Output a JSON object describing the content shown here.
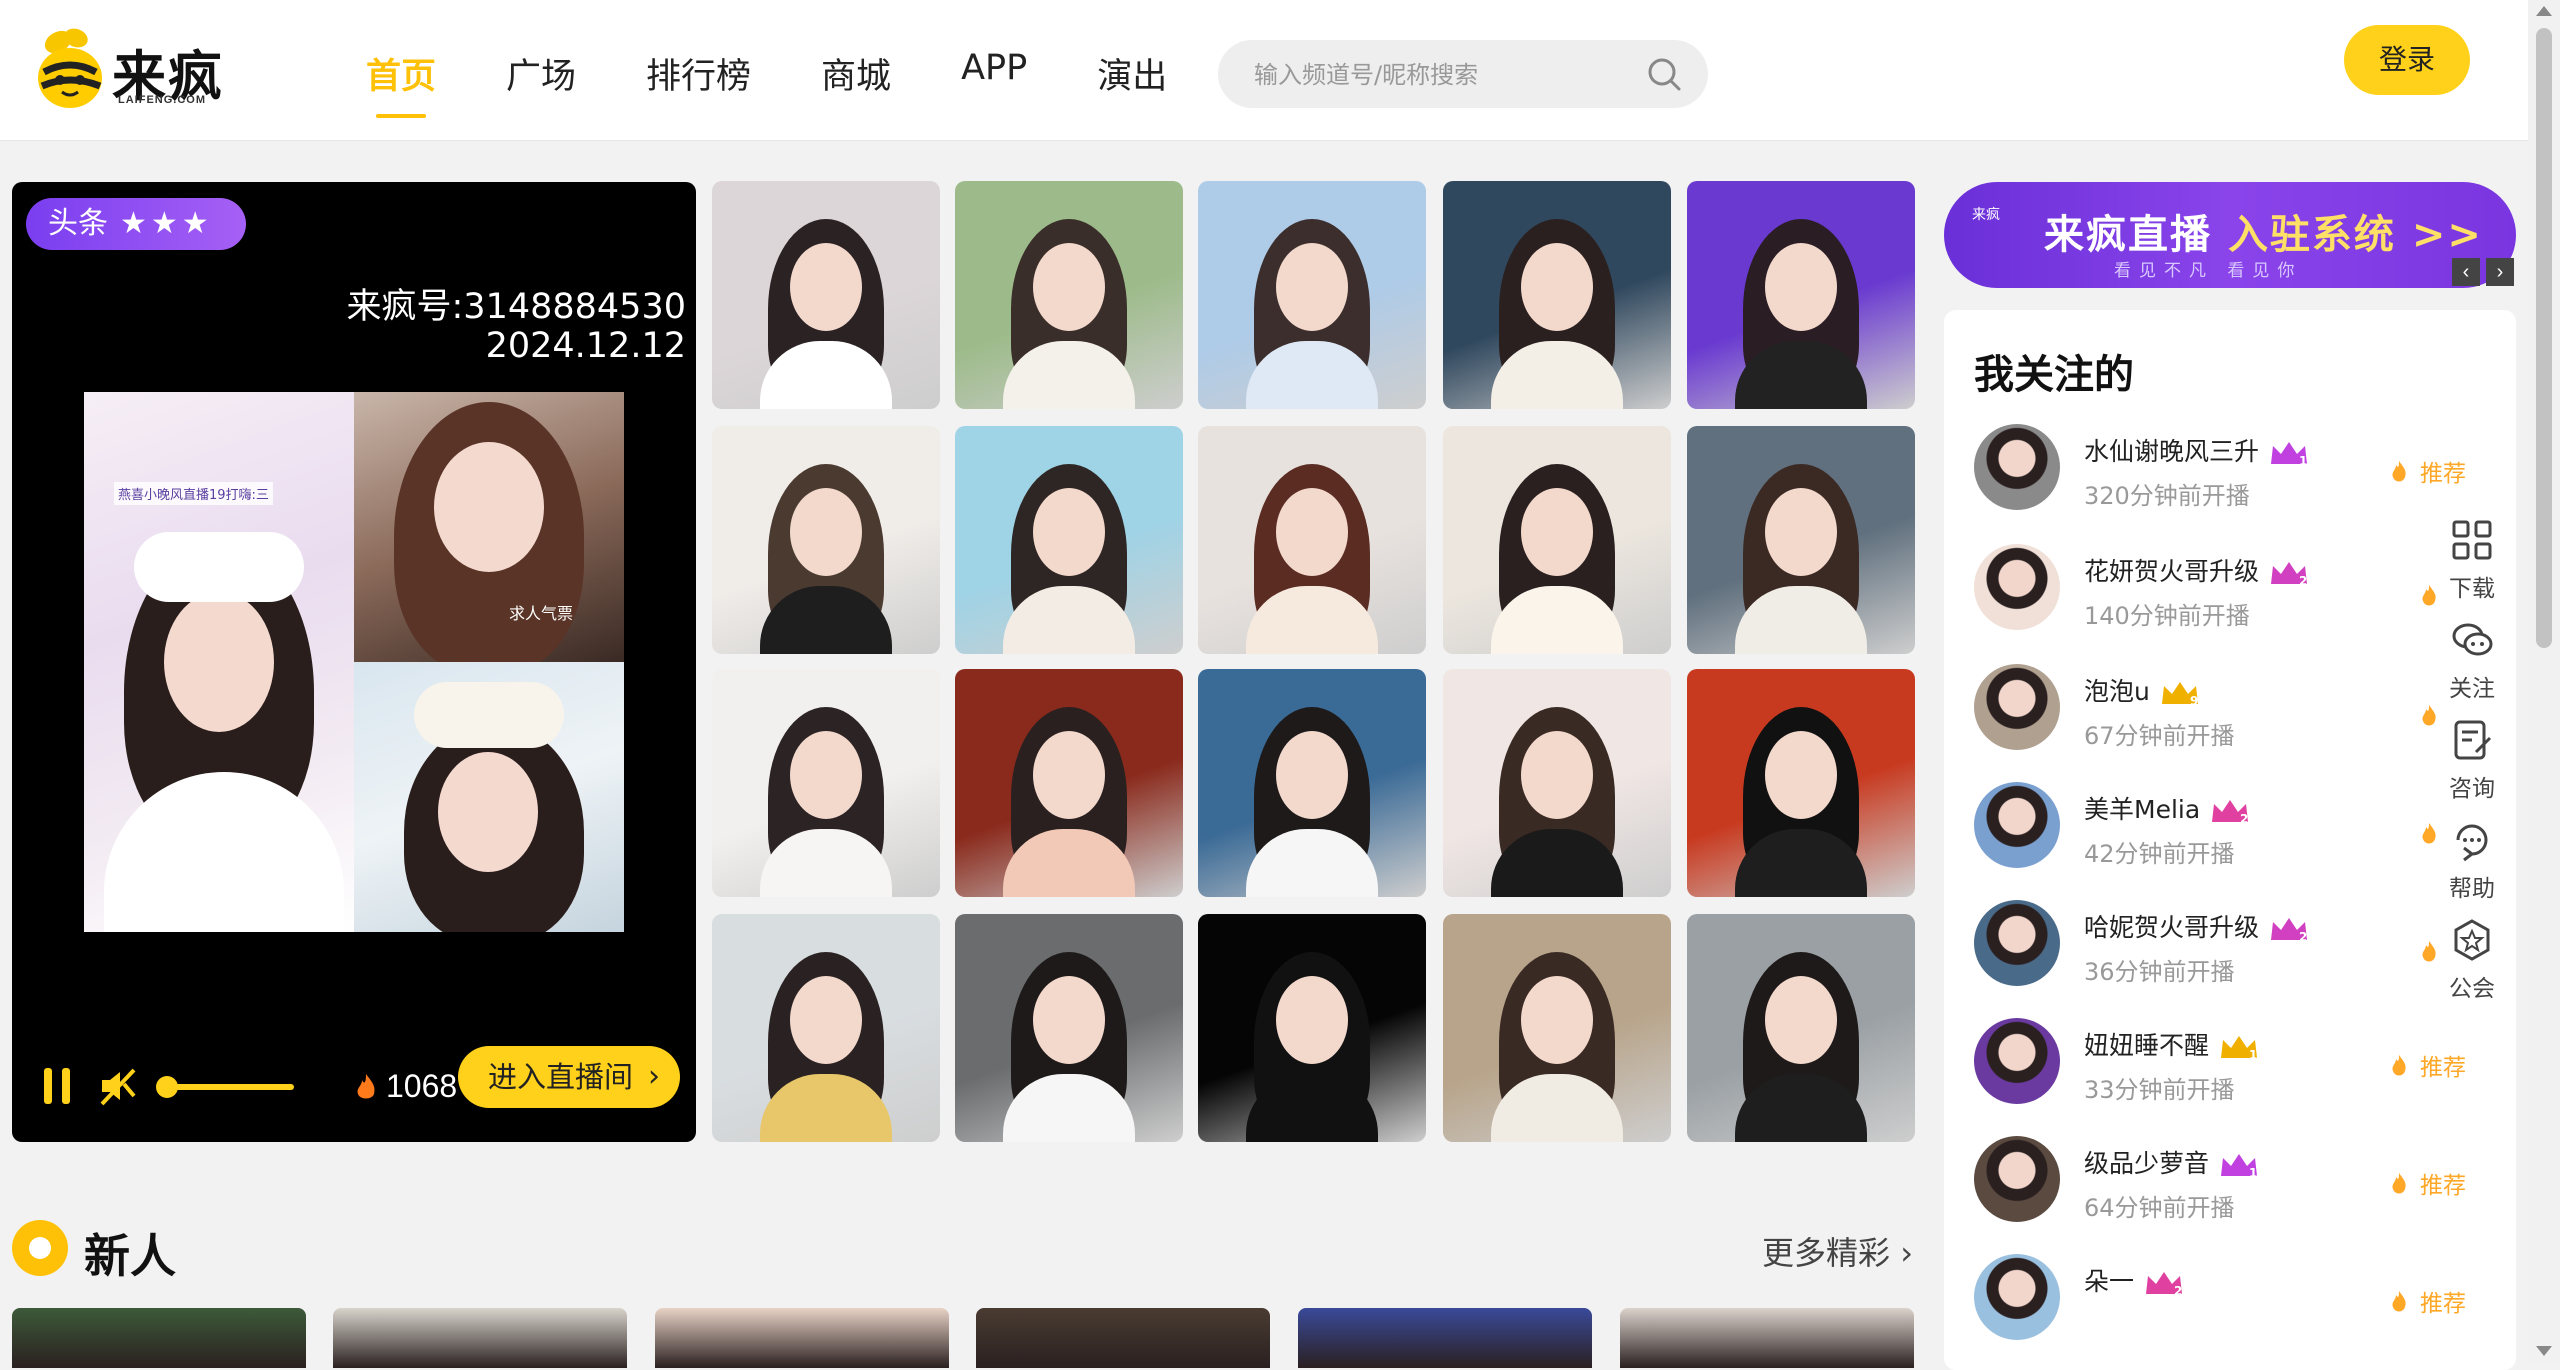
{
  "brand": {
    "name": "来疯",
    "sub": "LAIFENG.COM"
  },
  "nav": {
    "items": [
      "首页",
      "广场",
      "排行榜",
      "商城",
      "APP",
      "演出"
    ],
    "active": 0
  },
  "search": {
    "placeholder": "输入频道号/昵称搜索"
  },
  "header": {
    "login_label": "登录"
  },
  "featured": {
    "badge": "头条",
    "room_id": "来疯号:3148884530",
    "date": "2024.12.12",
    "video_tag": "燕喜小晚风直播19打嗨:三",
    "video_tag2": "求人气票",
    "heat": "1068",
    "enter_label": "进入直播间"
  },
  "section_new": {
    "title": "新人",
    "more": "更多精彩"
  },
  "promo": {
    "logo": "来疯",
    "title_a": "来疯直播",
    "title_b": "入驻系统 >>",
    "sub": "看见不凡 看见你"
  },
  "follow": {
    "title": "我关注的",
    "items": [
      {
        "name": "水仙谢晚风三升",
        "time": "320分钟前开播",
        "level": "16",
        "rec": "推荐"
      },
      {
        "name": "花妍贺火哥升级",
        "time": "140分钟前开播",
        "level": "20",
        "rec": ""
      },
      {
        "name": "泡泡u",
        "time": "67分钟前开播",
        "level": "9",
        "rec": ""
      },
      {
        "name": "美羊Melia",
        "time": "42分钟前开播",
        "level": "27",
        "rec": ""
      },
      {
        "name": "哈妮贺火哥升级",
        "time": "36分钟前开播",
        "level": "21",
        "rec": ""
      },
      {
        "name": "妞妞睡不醒",
        "time": "33分钟前开播",
        "level": "11",
        "rec": "推荐"
      },
      {
        "name": "级品少萝音",
        "time": "64分钟前开播",
        "level": "13",
        "rec": "推荐"
      },
      {
        "name": "朵一",
        "time": "",
        "level": "29",
        "rec": "推荐"
      }
    ]
  },
  "side_tools": [
    {
      "label": "下载",
      "icon": "qrcode-icon"
    },
    {
      "label": "关注",
      "icon": "chat-bubbles-icon"
    },
    {
      "label": "咨询",
      "icon": "edit-note-icon"
    },
    {
      "label": "帮助",
      "icon": "refresh-help-icon"
    },
    {
      "label": "公会",
      "icon": "star-shield-icon"
    }
  ],
  "colors": {
    "accent": "#ffc107",
    "button": "#ffd11a",
    "badge": "#8a44ea",
    "promo": "#7a35e0"
  }
}
